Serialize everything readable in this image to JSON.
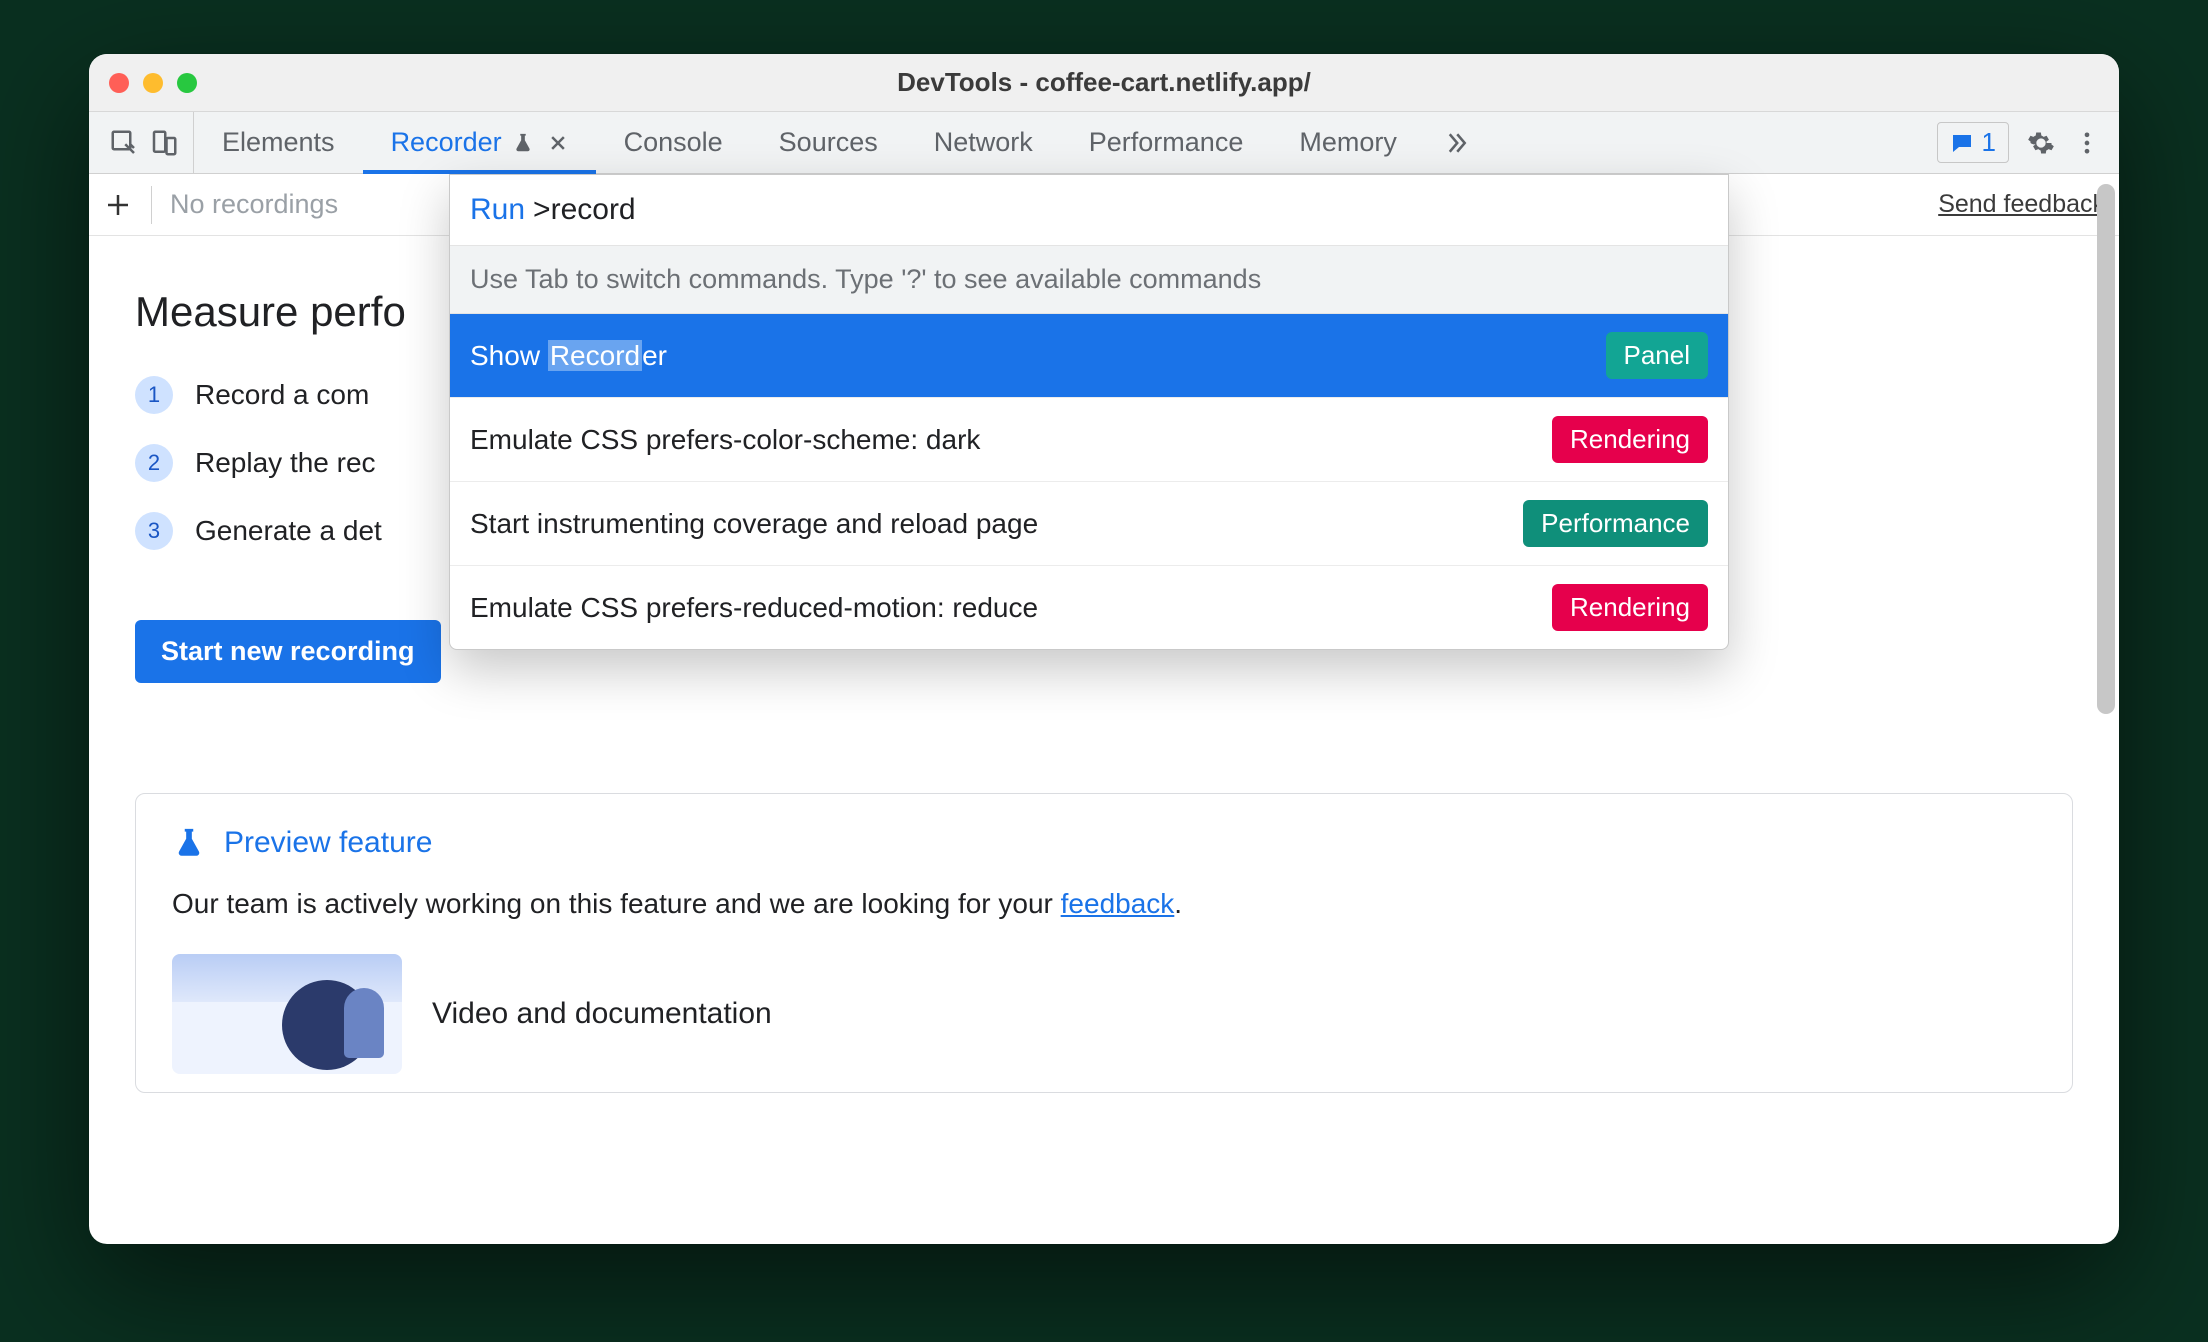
{
  "window": {
    "title": "DevTools - coffee-cart.netlify.app/"
  },
  "tabstrip": {
    "tabs": [
      "Elements",
      "Recorder",
      "Console",
      "Sources",
      "Network",
      "Performance",
      "Memory"
    ],
    "active_index": 1,
    "message_count": "1"
  },
  "subbar": {
    "no_recordings": "No recordings",
    "send_feedback": "Send feedback"
  },
  "main": {
    "heading": "Measure perfo",
    "steps": [
      "Record a com",
      "Replay the rec",
      "Generate a det"
    ],
    "start_button": "Start new recording",
    "preview": {
      "title": "Preview feature",
      "desc_prefix": "Our team is actively working on this feature and we are looking for your ",
      "desc_link": "feedback",
      "desc_suffix": ".",
      "video_label": "Video and documentation"
    }
  },
  "palette": {
    "prompt_label": "Run",
    "prompt_prefix": ">",
    "query": "record",
    "hint": "Use Tab to switch commands. Type '?' to see available commands",
    "items": [
      {
        "label": "Show Recorder",
        "badge": "Panel",
        "badge_kind": "panel",
        "selected": true
      },
      {
        "label": "Emulate CSS prefers-color-scheme: dark",
        "badge": "Rendering",
        "badge_kind": "rendering",
        "selected": false
      },
      {
        "label": "Start instrumenting coverage and reload page",
        "badge": "Performance",
        "badge_kind": "performance",
        "selected": false
      },
      {
        "label": "Emulate CSS prefers-reduced-motion: reduce",
        "badge": "Rendering",
        "badge_kind": "rendering",
        "selected": false
      }
    ]
  }
}
